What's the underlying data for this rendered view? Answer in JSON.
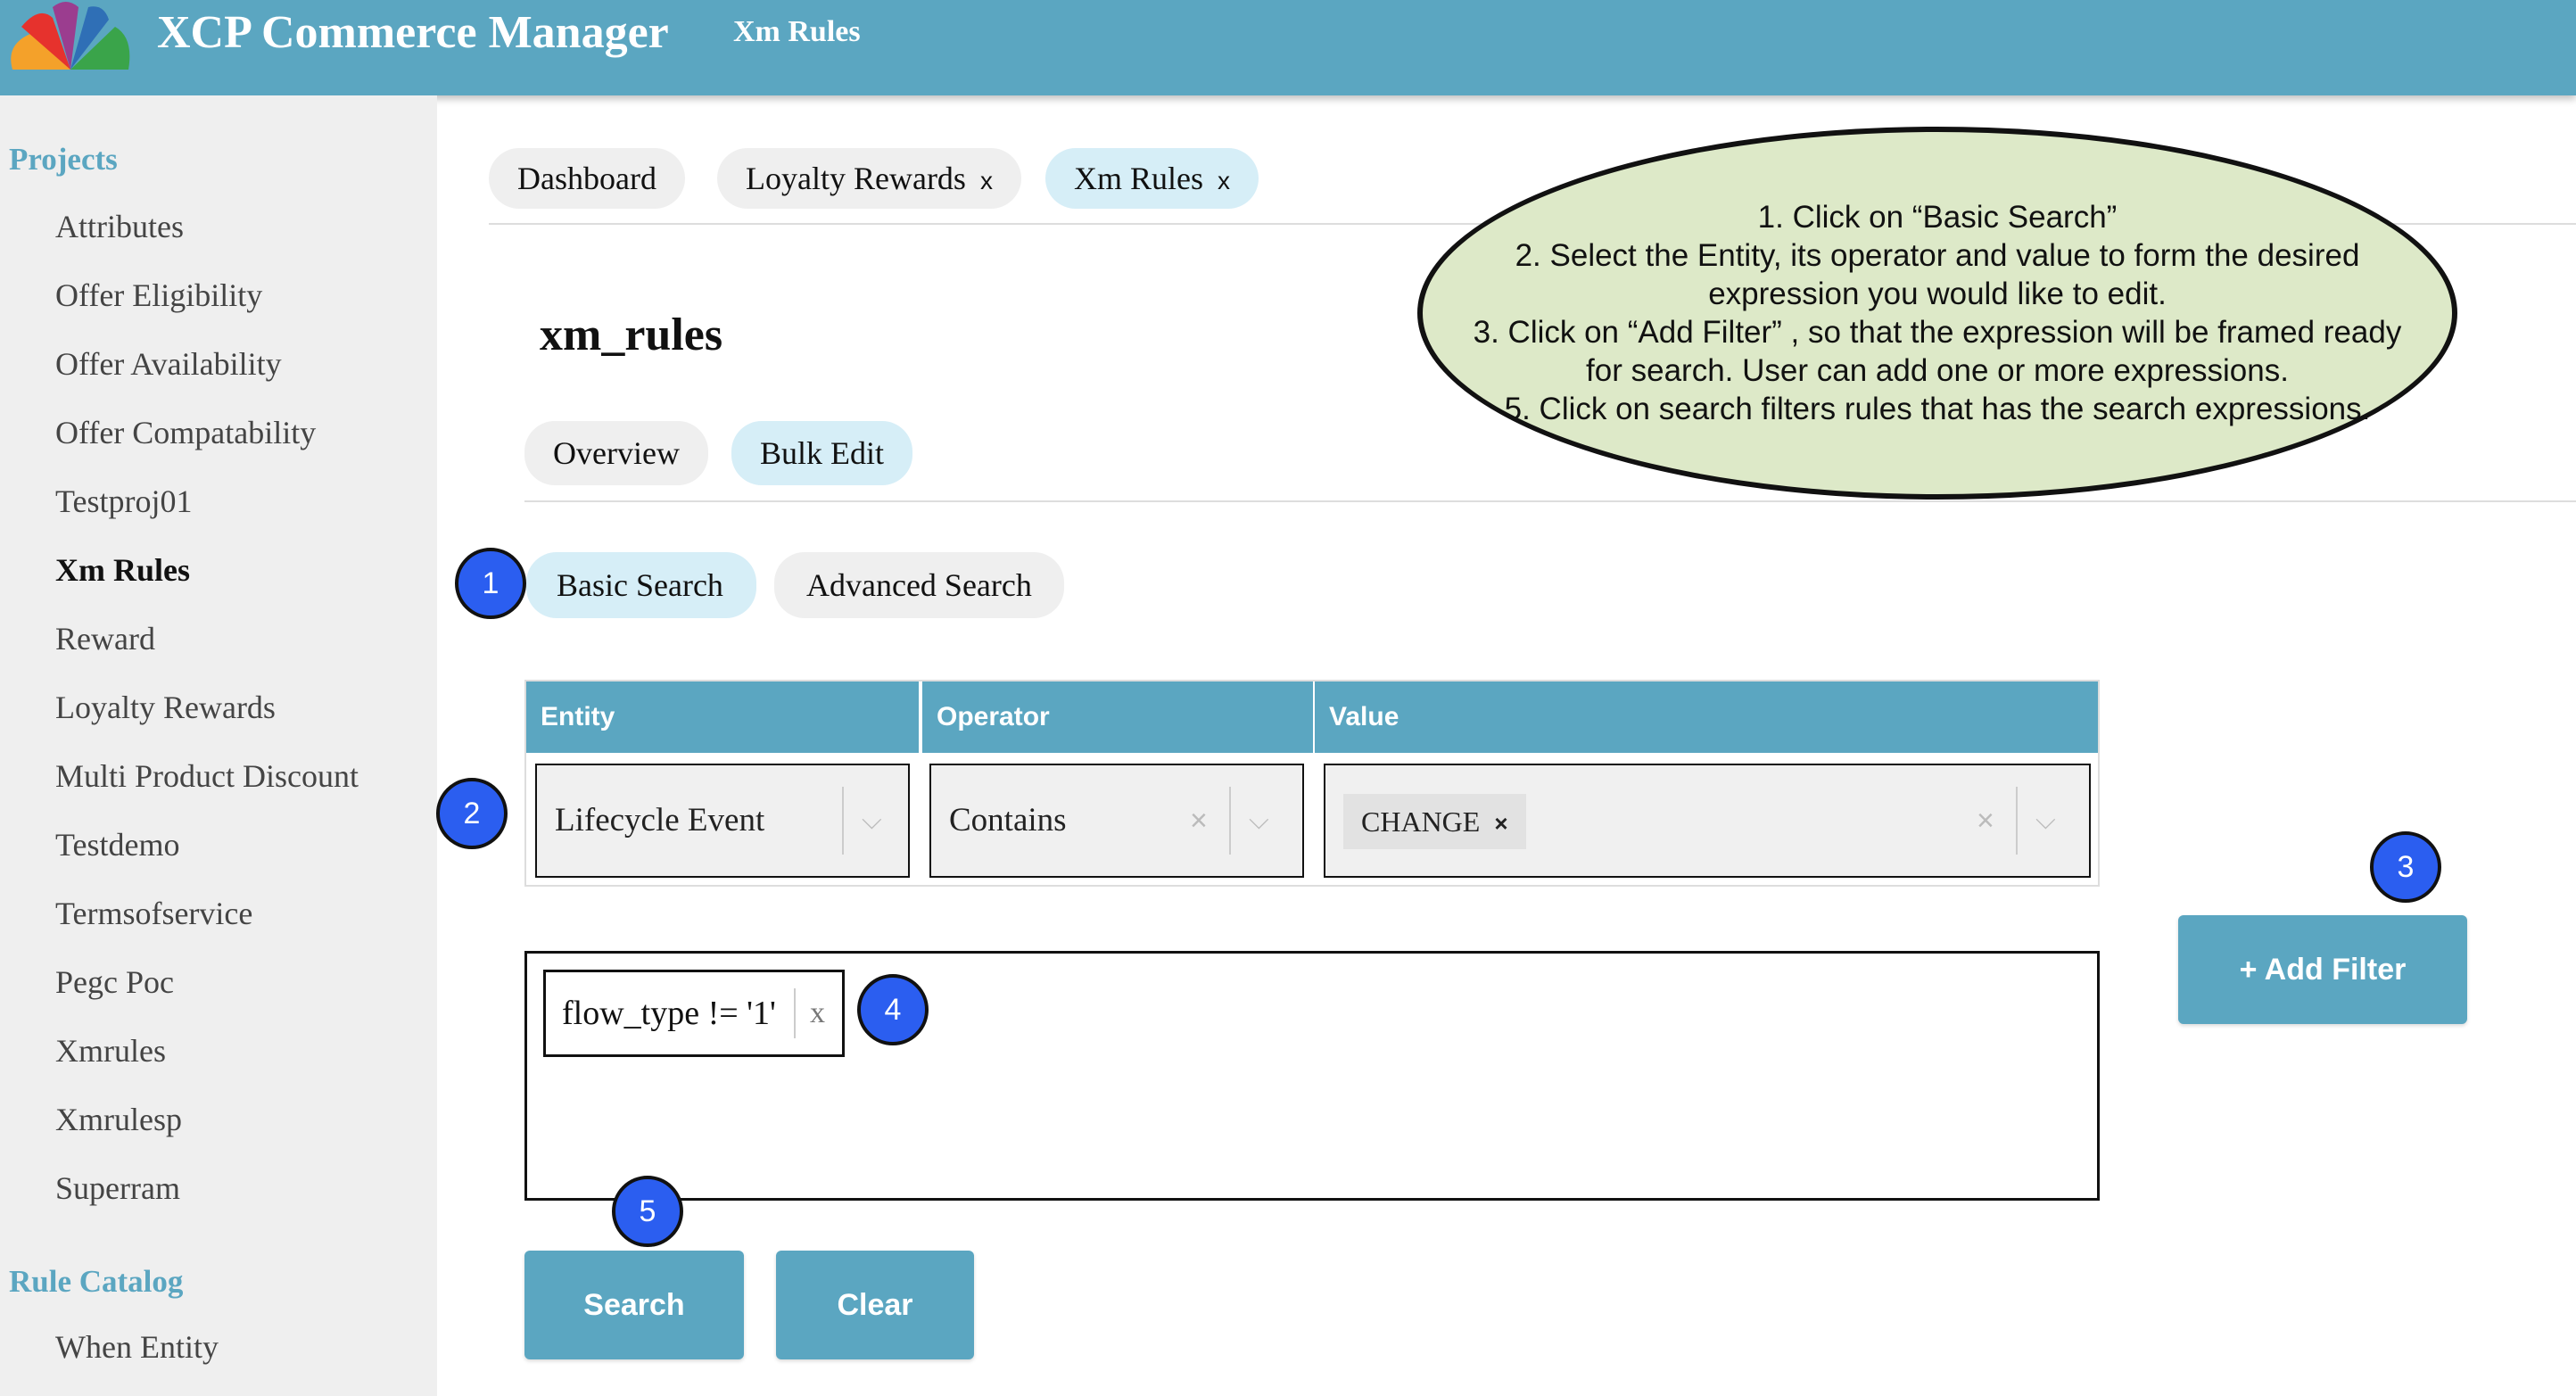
{
  "header": {
    "app_title": "XCP Commerce Manager",
    "page_name": "Xm Rules"
  },
  "sidebar": {
    "projects_label": "Projects",
    "items": [
      {
        "label": "Attributes"
      },
      {
        "label": "Offer Eligibility"
      },
      {
        "label": "Offer Availability"
      },
      {
        "label": "Offer Compatability"
      },
      {
        "label": "Testproj01"
      },
      {
        "label": "Xm Rules",
        "active": true
      },
      {
        "label": "Reward"
      },
      {
        "label": "Loyalty Rewards"
      },
      {
        "label": "Multi Product Discount"
      },
      {
        "label": "Testdemo"
      },
      {
        "label": "Termsofservice"
      },
      {
        "label": "Pegc Poc"
      },
      {
        "label": "Xmrules"
      },
      {
        "label": "Xmrulesp"
      },
      {
        "label": "Superram"
      }
    ],
    "catalog_label": "Rule Catalog",
    "catalog_items": [
      {
        "label": "When Entity"
      }
    ]
  },
  "tabs": [
    {
      "label": "Dashboard",
      "closable": false
    },
    {
      "label": "Loyalty Rewards",
      "closable": true
    },
    {
      "label": "Xm Rules",
      "closable": true,
      "active": true
    }
  ],
  "tab_close_glyph": "x",
  "page_title": "xm_rules",
  "subtabs": [
    {
      "label": "Overview"
    },
    {
      "label": "Bulk Edit",
      "active": true
    }
  ],
  "search_modes": [
    {
      "label": "Basic Search",
      "active": true
    },
    {
      "label": "Advanced Search"
    }
  ],
  "filter_table": {
    "headers": [
      "Entity",
      "Operator",
      "Value"
    ],
    "entity_value": "Lifecycle Event",
    "operator_value": "Contains",
    "value_chip": "CHANGE",
    "value_chip_remove": "×",
    "clear_glyph": "×",
    "chevron_glyph": "⌵"
  },
  "add_filter_label": "+ Add Filter",
  "expression": {
    "text": "flow_type != '1'",
    "remove": "x"
  },
  "buttons": {
    "search": "Search",
    "clear": "Clear"
  },
  "badges": [
    "1",
    "2",
    "3",
    "4",
    "5"
  ],
  "callout": {
    "lines": [
      "1. Click on “Basic Search”",
      "2. Select the Entity, its operator and value to form the desired expression you would like to edit.",
      "3. Click on “Add Filter” , so that the expression will be framed ready for search. User can add one or more expressions.",
      "5. Click on search filters rules that has the search expressions."
    ]
  },
  "colors": {
    "header": "#5ba6c1",
    "active_pill": "#d6eef7",
    "badge": "#2b5ef0",
    "callout": "#dde9c8"
  }
}
